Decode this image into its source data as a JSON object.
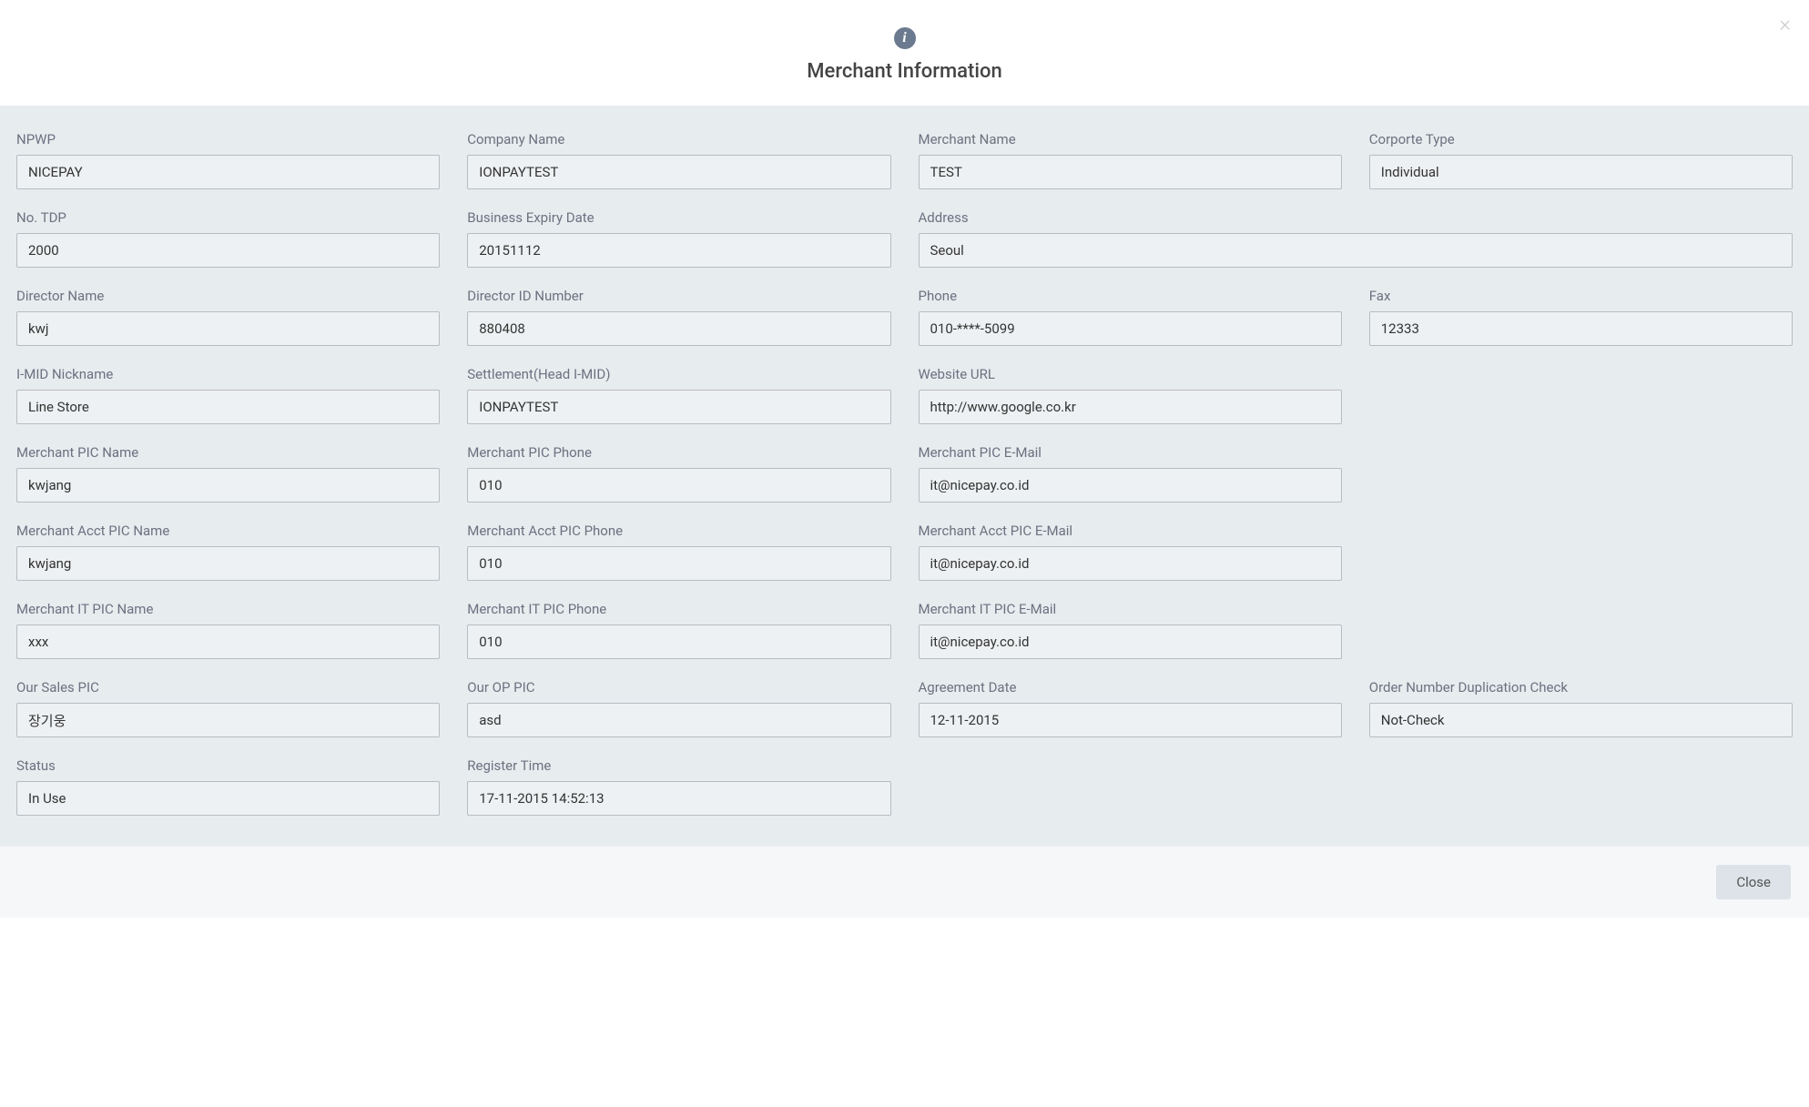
{
  "header": {
    "title": "Merchant Information",
    "info_icon_glyph": "i",
    "close_x": "×"
  },
  "fields": {
    "npwp": {
      "label": "NPWP",
      "value": "NICEPAY"
    },
    "company_name": {
      "label": "Company Name",
      "value": "IONPAYTEST"
    },
    "merchant_name": {
      "label": "Merchant Name",
      "value": "TEST"
    },
    "corporate_type": {
      "label": "Corporte Type",
      "value": "Individual"
    },
    "no_tdp": {
      "label": "No. TDP",
      "value": "2000"
    },
    "business_expiry_date": {
      "label": "Business Expiry Date",
      "value": "20151112"
    },
    "address": {
      "label": "Address",
      "value": "Seoul"
    },
    "director_name": {
      "label": "Director Name",
      "value": "kwj"
    },
    "director_id_number": {
      "label": "Director ID Number",
      "value": "880408"
    },
    "phone": {
      "label": "Phone",
      "value": "010-****-5099"
    },
    "fax": {
      "label": "Fax",
      "value": "12333"
    },
    "imid_nickname": {
      "label": "I-MID Nickname",
      "value": "Line Store"
    },
    "settlement_head_imid": {
      "label": "Settlement(Head I-MID)",
      "value": "IONPAYTEST"
    },
    "website_url": {
      "label": "Website URL",
      "value": "http://www.google.co.kr"
    },
    "merchant_pic_name": {
      "label": "Merchant PIC Name",
      "value": "kwjang"
    },
    "merchant_pic_phone": {
      "label": "Merchant PIC Phone",
      "value": "010"
    },
    "merchant_pic_email": {
      "label": "Merchant PIC E-Mail",
      "value": "it@nicepay.co.id"
    },
    "merchant_acct_pic_name": {
      "label": "Merchant Acct PIC Name",
      "value": "kwjang"
    },
    "merchant_acct_pic_phone": {
      "label": "Merchant Acct PIC Phone",
      "value": "010"
    },
    "merchant_acct_pic_email": {
      "label": "Merchant Acct PIC E-Mail",
      "value": "it@nicepay.co.id"
    },
    "merchant_it_pic_name": {
      "label": "Merchant IT PIC Name",
      "value": "xxx"
    },
    "merchant_it_pic_phone": {
      "label": "Merchant IT PIC Phone",
      "value": "010"
    },
    "merchant_it_pic_email": {
      "label": "Merchant IT PIC E-Mail",
      "value": "it@nicepay.co.id"
    },
    "our_sales_pic": {
      "label": "Our Sales PIC",
      "value": "장기웅"
    },
    "our_op_pic": {
      "label": "Our OP PIC",
      "value": "asd"
    },
    "agreement_date": {
      "label": "Agreement Date",
      "value": "12-11-2015"
    },
    "order_number_dup_check": {
      "label": "Order Number Duplication Check",
      "value": "Not-Check"
    },
    "status": {
      "label": "Status",
      "value": "In Use"
    },
    "register_time": {
      "label": "Register Time",
      "value": "17-11-2015 14:52:13"
    }
  },
  "footer": {
    "close_label": "Close"
  }
}
